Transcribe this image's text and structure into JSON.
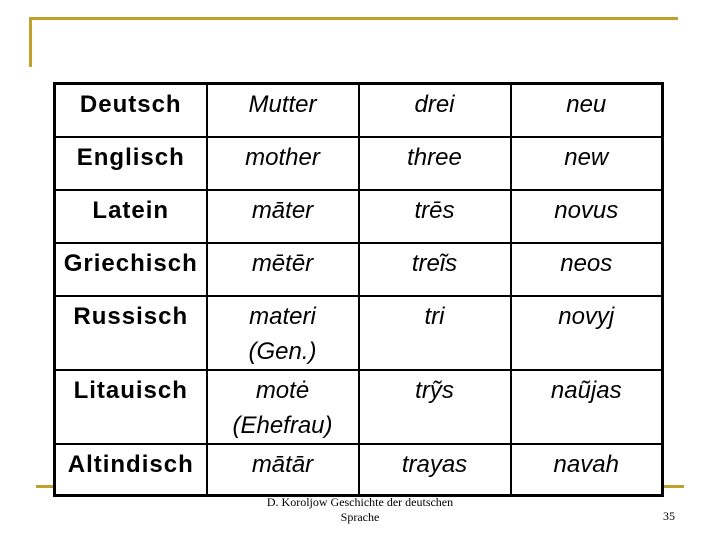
{
  "slide": {
    "accent_color": "#C2A02E",
    "footer": {
      "line1": "D. Koroljow Geschichte der deutschen",
      "line2": "Sprache"
    },
    "page_number": "35"
  },
  "table": {
    "rows": [
      {
        "language": "Deutsch",
        "values": [
          [
            "Mutter"
          ],
          [
            "drei"
          ],
          [
            "neu"
          ]
        ]
      },
      {
        "language": "Englisch",
        "values": [
          [
            "mother"
          ],
          [
            "three"
          ],
          [
            "new"
          ]
        ]
      },
      {
        "language": "Latein",
        "values": [
          [
            "māter"
          ],
          [
            "trēs"
          ],
          [
            "novus"
          ]
        ]
      },
      {
        "language": "Griechisch",
        "values": [
          [
            "mētēr"
          ],
          [
            "treĩs"
          ],
          [
            "neos"
          ]
        ]
      },
      {
        "language": "Russisch",
        "values": [
          [
            "materi",
            "(Gen.)"
          ],
          [
            "tri"
          ],
          [
            "novyj"
          ]
        ]
      },
      {
        "language": "Litauisch",
        "values": [
          [
            "motė",
            "(Ehefrau)"
          ],
          [
            "trỹs"
          ],
          [
            "naũjas"
          ]
        ]
      },
      {
        "language": "Altindisch",
        "values": [
          [
            "mātār"
          ],
          [
            "trayas"
          ],
          [
            "navah"
          ]
        ]
      }
    ]
  }
}
